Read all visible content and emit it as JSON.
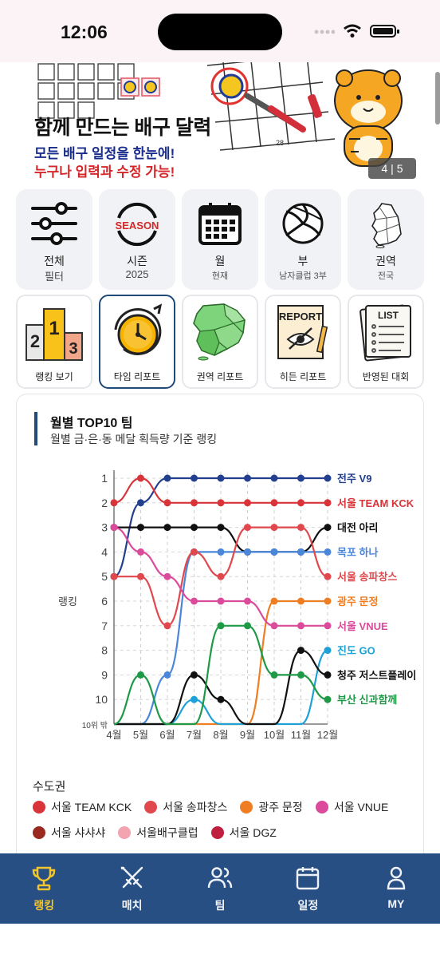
{
  "status": {
    "time": "12:06"
  },
  "banner": {
    "title": "함께 만드는 배구 달력",
    "subtitle1": "모든 배구 일정을 한눈에!",
    "subtitle2": "누구나 입력과 수정 가능!",
    "counter": "4 | 5"
  },
  "menu_row1": [
    {
      "label": "전체",
      "sub": "필터",
      "icon": "filter-sliders-icon"
    },
    {
      "label": "시즌",
      "sub": "2025",
      "icon": "season-logo-icon",
      "icon_text": "SEASON"
    },
    {
      "label": "월",
      "sub": "현재",
      "icon": "calendar-icon"
    },
    {
      "label": "부",
      "sub": "남자클럽 3부",
      "icon": "volleyball-icon"
    },
    {
      "label": "권역",
      "sub": "전국",
      "icon": "korea-map-icon"
    }
  ],
  "menu_row2": [
    {
      "label": "랭킹 보기",
      "icon": "podium-icon",
      "podium": [
        "2",
        "1",
        "3"
      ]
    },
    {
      "label": "타임 리포트",
      "icon": "stopwatch-icon",
      "active": true
    },
    {
      "label": "권역 리포트",
      "icon": "region-map-icon"
    },
    {
      "label": "히든 리포트",
      "icon": "hidden-report-icon",
      "icon_text": "REPORT"
    },
    {
      "label": "반영된 대회",
      "icon": "list-clipboard-icon",
      "icon_text": "LIST"
    }
  ],
  "chart_card": {
    "title": "월별 TOP10 팀",
    "subtitle": "월별 금·은·동 메달 획득량 기준 랭킹"
  },
  "chart_data": {
    "type": "line",
    "title": "월별 TOP10 팀",
    "subtitle": "월별 금·은·동 메달 획득량 기준 랭킹",
    "ylabel": "랭킹",
    "xlabel": "",
    "categories": [
      "4월",
      "5월",
      "6월",
      "7월",
      "8월",
      "9월",
      "10월",
      "11월",
      "12월"
    ],
    "y_ticks": [
      "1",
      "2",
      "3",
      "4",
      "5",
      "6",
      "7",
      "8",
      "9",
      "10",
      "10위 밖"
    ],
    "ylim": [
      1,
      11
    ],
    "out_of_range_value": 11,
    "grid": true,
    "series": [
      {
        "name": "전주 V9",
        "color": "#23408e",
        "values": [
          5,
          2,
          1,
          1,
          1,
          1,
          1,
          1,
          1
        ]
      },
      {
        "name": "서울 TEAM KCK",
        "color": "#d8343a",
        "values": [
          2,
          1,
          2,
          2,
          2,
          2,
          2,
          2,
          2
        ]
      },
      {
        "name": "대전 아리",
        "color": "#111111",
        "values": [
          3,
          3,
          3,
          3,
          3,
          4,
          4,
          4,
          3
        ]
      },
      {
        "name": "목포 하나",
        "color": "#4a86d9",
        "values": [
          11,
          11,
          9,
          4,
          4,
          4,
          4,
          4,
          4
        ]
      },
      {
        "name": "서울 송파창스",
        "color": "#e0484d",
        "values": [
          5,
          5,
          7,
          4,
          5,
          3,
          3,
          3,
          5
        ]
      },
      {
        "name": "광주 문정",
        "color": "#ef7d22",
        "values": [
          11,
          11,
          11,
          11,
          11,
          11,
          6,
          6,
          6
        ]
      },
      {
        "name": "서울 VNUE",
        "color": "#dc4a9c",
        "values": [
          3,
          4,
          5,
          6,
          6,
          6,
          7,
          7,
          7
        ]
      },
      {
        "name": "진도 GO",
        "color": "#1ea1d6",
        "values": [
          11,
          11,
          11,
          10,
          11,
          11,
          11,
          11,
          8
        ]
      },
      {
        "name": "청주 저스트플레이",
        "color": "#111111",
        "values": [
          11,
          11,
          11,
          9,
          10,
          11,
          11,
          8,
          9
        ]
      },
      {
        "name": "부산 신과함께",
        "color": "#1e9a46",
        "values": [
          11,
          9,
          11,
          11,
          7,
          7,
          9,
          9,
          10
        ]
      }
    ],
    "end_labels": [
      "전주 V9",
      "서울 TEAM KCK",
      "대전 아리",
      "목포 하나",
      "서울 송파창스",
      "광주 문정",
      "서울 VNUE",
      "진도 GO",
      "청주 저스트플레이",
      "부산 신과함께"
    ]
  },
  "legend": {
    "group_title": "수도권",
    "items": [
      {
        "name": "서울 TEAM KCK",
        "color": "#d8343a"
      },
      {
        "name": "서울 송파창스",
        "color": "#e0484d"
      },
      {
        "name": "광주 문정",
        "color": "#ef7d22"
      },
      {
        "name": "서울 VNUE",
        "color": "#dc4a9c"
      },
      {
        "name": "서울 샤샤샤",
        "color": "#9a2a1f"
      },
      {
        "name": "서울배구클럽",
        "color": "#f4a3b1"
      },
      {
        "name": "서울 DGZ",
        "color": "#c01e3e"
      }
    ],
    "next_group_title": "…"
  },
  "tabbar": [
    {
      "label": "랭킹",
      "icon": "trophy-icon",
      "active": true
    },
    {
      "label": "매치",
      "icon": "crossed-swords-icon"
    },
    {
      "label": "팀",
      "icon": "people-icon"
    },
    {
      "label": "일정",
      "icon": "calendar-icon"
    },
    {
      "label": "MY",
      "icon": "person-icon"
    }
  ]
}
